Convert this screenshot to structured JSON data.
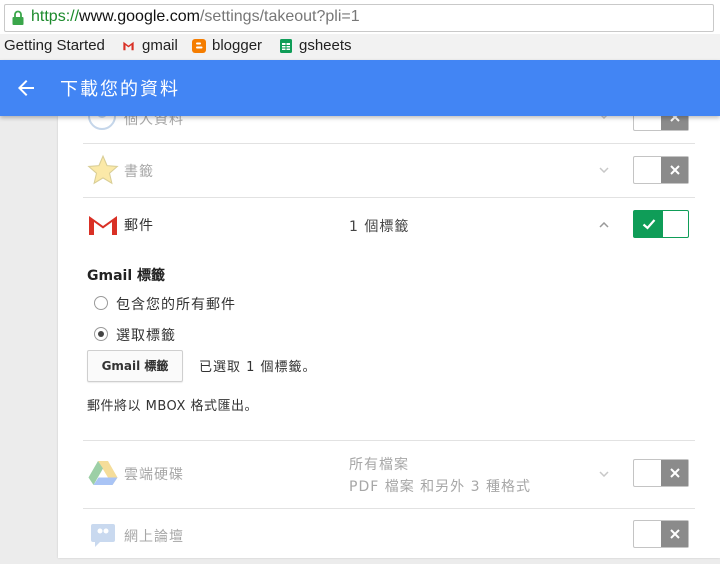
{
  "browser": {
    "url_scheme": "https://",
    "url_host": "www.google.com",
    "url_path": "/settings/takeout?pli=1",
    "bookmarks": [
      {
        "label": "Getting Started",
        "icon": "none"
      },
      {
        "label": "gmail",
        "icon": "gmail-icon"
      },
      {
        "label": "blogger",
        "icon": "blogger-icon"
      },
      {
        "label": "gsheets",
        "icon": "sheets-icon"
      }
    ]
  },
  "appbar": {
    "title": "下載您的資料",
    "color": "#4285f4"
  },
  "products": [
    {
      "name": "個人資料",
      "icon": "profile-icon",
      "state": "off"
    },
    {
      "name": "書籤",
      "icon": "star-icon",
      "state": "off"
    },
    {
      "name": "郵件",
      "icon": "gmail-icon",
      "summary": "1 個標籤",
      "state": "on",
      "expanded": true
    },
    {
      "name": "雲端硬碟",
      "icon": "drive-icon",
      "summary_line1": "所有檔案",
      "summary_line2": "PDF 檔案 和另外 3 種格式",
      "state": "off"
    },
    {
      "name": "網上論壇",
      "icon": "groups-icon",
      "state": "off"
    }
  ],
  "gmail_options": {
    "heading": "Gmail 標籤",
    "option_all": "包含您的所有郵件",
    "option_select": "選取標籤",
    "selected_option": "選取標籤",
    "labels_button": "Gmail 標籤",
    "selected_note": "已選取 1 個標籤。",
    "format_note": "郵件將以 MBOX 格式匯出。"
  },
  "colors": {
    "toggle_on": "#0f9d58",
    "toggle_off": "#8b8b8b"
  }
}
